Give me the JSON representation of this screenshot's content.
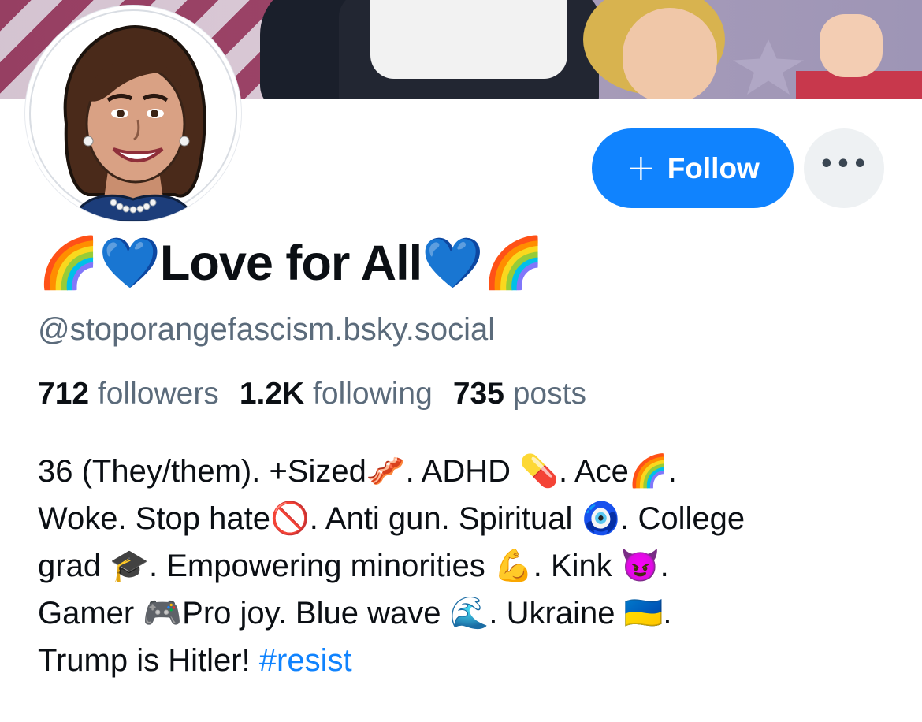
{
  "profile": {
    "display_name": "🌈💙Love for All💙🌈",
    "handle": "@stoporangefascism.bsky.social",
    "stats": {
      "followers_count": "712",
      "followers_label": "followers",
      "following_count": "1.2K",
      "following_label": "following",
      "posts_count": "735",
      "posts_label": "posts"
    },
    "bio": {
      "line1": "36 (They/them).  +Sized🥓.  ADHD 💊. Ace🌈.",
      "line2": "Woke. Stop hate🚫. Anti gun. Spiritual 🧿. College",
      "line3": "grad 🎓. Empowering minorities 💪. Kink 😈.",
      "line4": "Gamer 🎮Pro joy. Blue wave 🌊. Ukraine 🇺🇦.",
      "line5_text": "Trump is Hitler! ",
      "hashtag": "#resist"
    }
  },
  "actions": {
    "follow_icon": "plus-icon",
    "follow_label": "Follow",
    "more_icon": "ellipsis-icon",
    "more_label": "•••"
  },
  "colors": {
    "accent": "#1083fe",
    "muted_text": "#5b6b7b",
    "secondary_button_bg": "#eef1f3"
  }
}
